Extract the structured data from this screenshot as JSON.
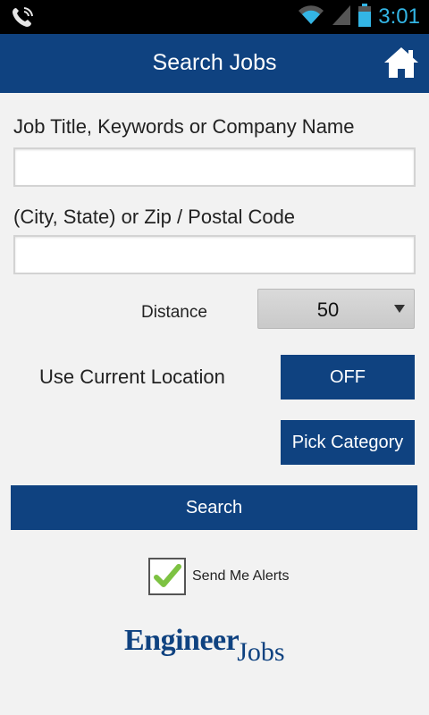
{
  "status_bar": {
    "time": "3:01",
    "icons": [
      "phone-call-icon",
      "wifi-icon",
      "cell-signal-icon",
      "battery-icon"
    ],
    "accent_color": "#33b5e5"
  },
  "app_bar": {
    "title": "Search Jobs",
    "home_icon": "home-icon",
    "color": "#0f4280"
  },
  "form": {
    "keywords_label": "Job Title, Keywords or Company Name",
    "keywords_value": "",
    "location_label": "(City, State) or Zip / Postal Code",
    "location_value": "",
    "distance_label": "Distance",
    "distance_value": "50",
    "current_location_label": "Use Current Location",
    "current_location_toggle": "OFF",
    "pick_category_label": "Pick Category",
    "search_button": "Search",
    "alerts_label": "Send Me Alerts",
    "alerts_checked": true
  },
  "logo": {
    "word1": "Engineer",
    "word2": "Jobs"
  }
}
